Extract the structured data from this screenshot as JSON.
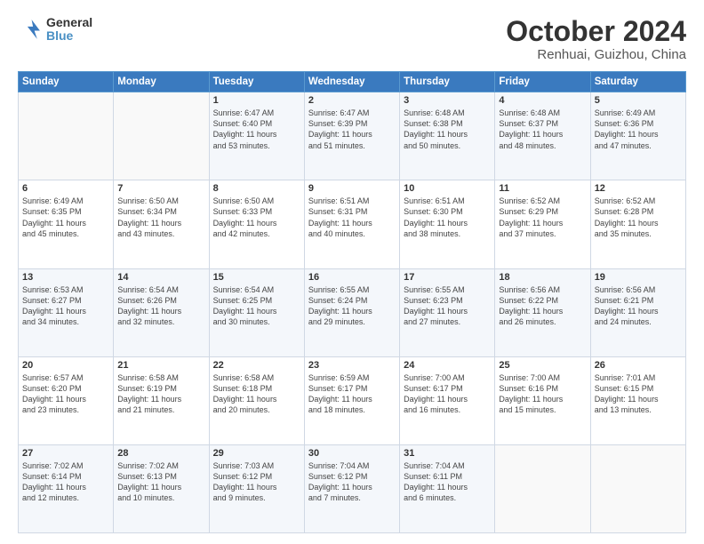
{
  "header": {
    "logo_line1": "General",
    "logo_line2": "Blue",
    "title": "October 2024",
    "subtitle": "Renhuai, Guizhou, China"
  },
  "columns": [
    "Sunday",
    "Monday",
    "Tuesday",
    "Wednesday",
    "Thursday",
    "Friday",
    "Saturday"
  ],
  "weeks": [
    [
      {
        "day": "",
        "info": ""
      },
      {
        "day": "",
        "info": ""
      },
      {
        "day": "1",
        "info": "Sunrise: 6:47 AM\nSunset: 6:40 PM\nDaylight: 11 hours\nand 53 minutes."
      },
      {
        "day": "2",
        "info": "Sunrise: 6:47 AM\nSunset: 6:39 PM\nDaylight: 11 hours\nand 51 minutes."
      },
      {
        "day": "3",
        "info": "Sunrise: 6:48 AM\nSunset: 6:38 PM\nDaylight: 11 hours\nand 50 minutes."
      },
      {
        "day": "4",
        "info": "Sunrise: 6:48 AM\nSunset: 6:37 PM\nDaylight: 11 hours\nand 48 minutes."
      },
      {
        "day": "5",
        "info": "Sunrise: 6:49 AM\nSunset: 6:36 PM\nDaylight: 11 hours\nand 47 minutes."
      }
    ],
    [
      {
        "day": "6",
        "info": "Sunrise: 6:49 AM\nSunset: 6:35 PM\nDaylight: 11 hours\nand 45 minutes."
      },
      {
        "day": "7",
        "info": "Sunrise: 6:50 AM\nSunset: 6:34 PM\nDaylight: 11 hours\nand 43 minutes."
      },
      {
        "day": "8",
        "info": "Sunrise: 6:50 AM\nSunset: 6:33 PM\nDaylight: 11 hours\nand 42 minutes."
      },
      {
        "day": "9",
        "info": "Sunrise: 6:51 AM\nSunset: 6:31 PM\nDaylight: 11 hours\nand 40 minutes."
      },
      {
        "day": "10",
        "info": "Sunrise: 6:51 AM\nSunset: 6:30 PM\nDaylight: 11 hours\nand 38 minutes."
      },
      {
        "day": "11",
        "info": "Sunrise: 6:52 AM\nSunset: 6:29 PM\nDaylight: 11 hours\nand 37 minutes."
      },
      {
        "day": "12",
        "info": "Sunrise: 6:52 AM\nSunset: 6:28 PM\nDaylight: 11 hours\nand 35 minutes."
      }
    ],
    [
      {
        "day": "13",
        "info": "Sunrise: 6:53 AM\nSunset: 6:27 PM\nDaylight: 11 hours\nand 34 minutes."
      },
      {
        "day": "14",
        "info": "Sunrise: 6:54 AM\nSunset: 6:26 PM\nDaylight: 11 hours\nand 32 minutes."
      },
      {
        "day": "15",
        "info": "Sunrise: 6:54 AM\nSunset: 6:25 PM\nDaylight: 11 hours\nand 30 minutes."
      },
      {
        "day": "16",
        "info": "Sunrise: 6:55 AM\nSunset: 6:24 PM\nDaylight: 11 hours\nand 29 minutes."
      },
      {
        "day": "17",
        "info": "Sunrise: 6:55 AM\nSunset: 6:23 PM\nDaylight: 11 hours\nand 27 minutes."
      },
      {
        "day": "18",
        "info": "Sunrise: 6:56 AM\nSunset: 6:22 PM\nDaylight: 11 hours\nand 26 minutes."
      },
      {
        "day": "19",
        "info": "Sunrise: 6:56 AM\nSunset: 6:21 PM\nDaylight: 11 hours\nand 24 minutes."
      }
    ],
    [
      {
        "day": "20",
        "info": "Sunrise: 6:57 AM\nSunset: 6:20 PM\nDaylight: 11 hours\nand 23 minutes."
      },
      {
        "day": "21",
        "info": "Sunrise: 6:58 AM\nSunset: 6:19 PM\nDaylight: 11 hours\nand 21 minutes."
      },
      {
        "day": "22",
        "info": "Sunrise: 6:58 AM\nSunset: 6:18 PM\nDaylight: 11 hours\nand 20 minutes."
      },
      {
        "day": "23",
        "info": "Sunrise: 6:59 AM\nSunset: 6:17 PM\nDaylight: 11 hours\nand 18 minutes."
      },
      {
        "day": "24",
        "info": "Sunrise: 7:00 AM\nSunset: 6:17 PM\nDaylight: 11 hours\nand 16 minutes."
      },
      {
        "day": "25",
        "info": "Sunrise: 7:00 AM\nSunset: 6:16 PM\nDaylight: 11 hours\nand 15 minutes."
      },
      {
        "day": "26",
        "info": "Sunrise: 7:01 AM\nSunset: 6:15 PM\nDaylight: 11 hours\nand 13 minutes."
      }
    ],
    [
      {
        "day": "27",
        "info": "Sunrise: 7:02 AM\nSunset: 6:14 PM\nDaylight: 11 hours\nand 12 minutes."
      },
      {
        "day": "28",
        "info": "Sunrise: 7:02 AM\nSunset: 6:13 PM\nDaylight: 11 hours\nand 10 minutes."
      },
      {
        "day": "29",
        "info": "Sunrise: 7:03 AM\nSunset: 6:12 PM\nDaylight: 11 hours\nand 9 minutes."
      },
      {
        "day": "30",
        "info": "Sunrise: 7:04 AM\nSunset: 6:12 PM\nDaylight: 11 hours\nand 7 minutes."
      },
      {
        "day": "31",
        "info": "Sunrise: 7:04 AM\nSunset: 6:11 PM\nDaylight: 11 hours\nand 6 minutes."
      },
      {
        "day": "",
        "info": ""
      },
      {
        "day": "",
        "info": ""
      }
    ]
  ]
}
